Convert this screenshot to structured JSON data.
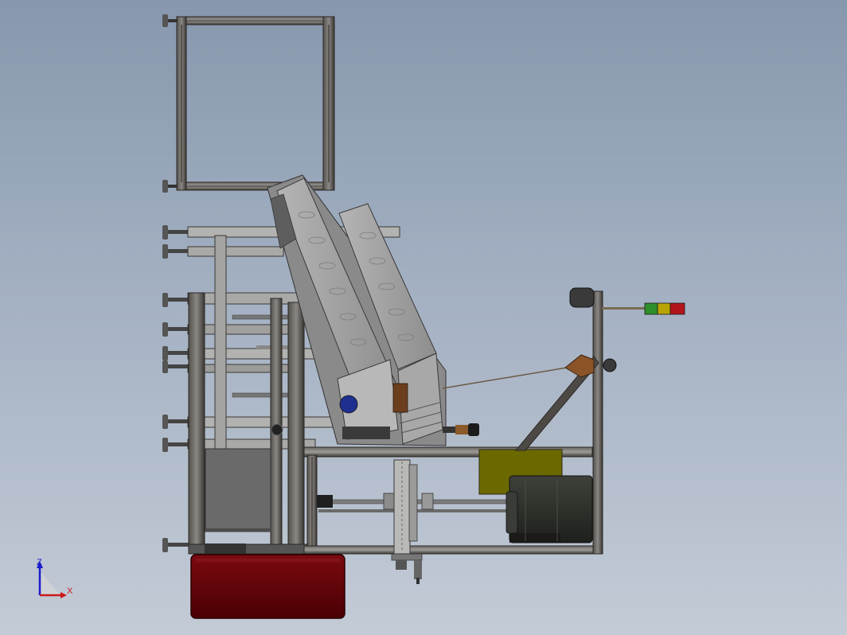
{
  "viewport": {
    "background_top": "#8797ad",
    "background_bottom": "#c3cbd6"
  },
  "colors": {
    "profile_dark": "#3d3a36",
    "profile_light": "#9a9a98",
    "panel_grey": "#a5a5a5",
    "panel_dark": "#5f5f5f",
    "tray_grey": "#9c9c9c",
    "bin_red": "#5a0006",
    "olive_box": "#6b6800",
    "motor_dark": "#2e302c",
    "signal_green": "#2f8f2a",
    "signal_yellow": "#b8a400",
    "signal_red": "#b3141b",
    "cone_brown": "#8a5328",
    "handle_black": "#1b1b1b",
    "blue_part": "#1f2f8f"
  },
  "components": [
    "top-square-frame",
    "leveling-feet",
    "inclined-conveyor",
    "main-frame",
    "cabinet-panel",
    "linear-actuator",
    "vertical-slide",
    "olive-control-box",
    "drive-motor",
    "light-post",
    "signal-tower-light",
    "conveyor-handle",
    "red-collection-bin"
  ],
  "signal_light_segments": [
    "green",
    "yellow",
    "red"
  ],
  "triad": {
    "z_label": "Z",
    "x_label": "X",
    "z_color": "#1a1acc",
    "x_color": "#cc1a1a"
  }
}
